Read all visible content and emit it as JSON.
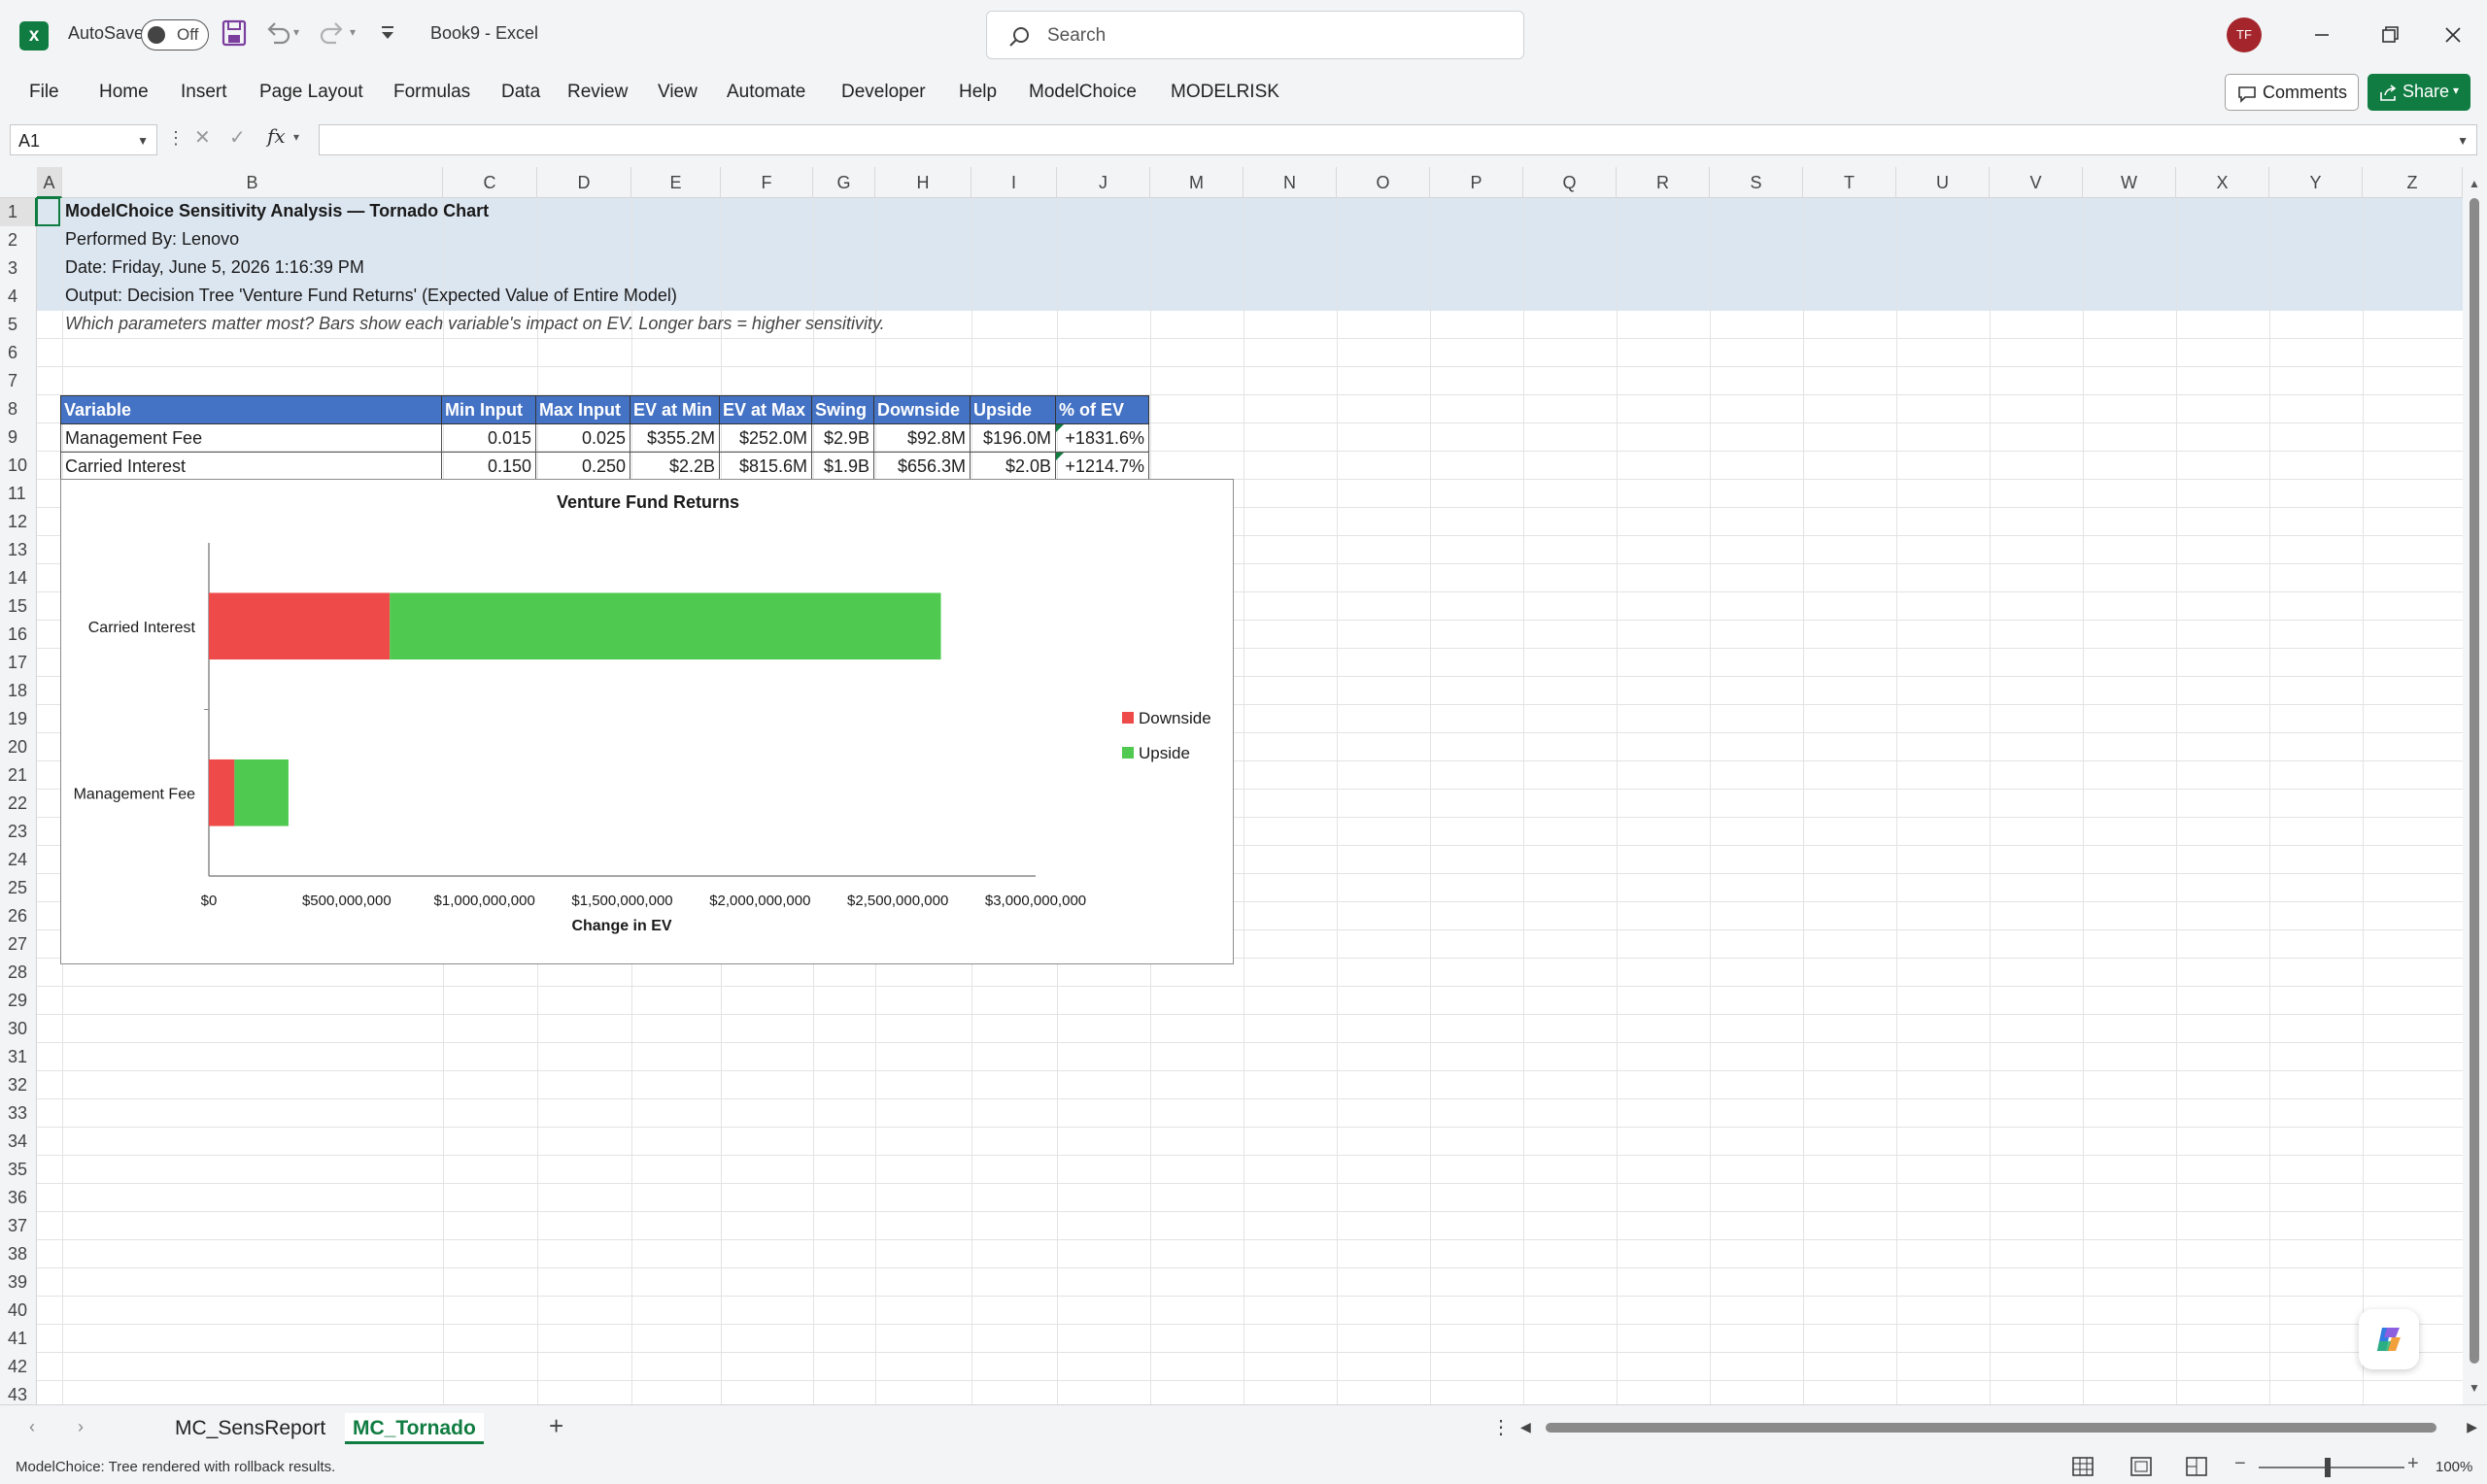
{
  "titlebar": {
    "autosave_label": "AutoSave",
    "autosave_state": "Off",
    "doc_title": "Book9  -  Excel",
    "search_placeholder": "Search",
    "user_initials": "TF",
    "icons": [
      "excel-logo-icon",
      "save-icon",
      "undo-icon",
      "redo-icon",
      "customize-qat-icon",
      "search-icon",
      "minimize-icon",
      "restore-icon",
      "close-icon"
    ]
  },
  "ribbon": {
    "tabs": [
      "File",
      "Home",
      "Insert",
      "Page Layout",
      "Formulas",
      "Data",
      "Review",
      "View",
      "Automate",
      "Developer",
      "Help",
      "ModelChoice",
      "MODELRISK"
    ],
    "comments_label": "Comments",
    "share_label": "Share"
  },
  "formula_bar": {
    "name_box": "A1",
    "formula": ""
  },
  "columns": [
    "A",
    "B",
    "C",
    "D",
    "E",
    "F",
    "G",
    "H",
    "I",
    "J",
    "M",
    "N",
    "O",
    "P",
    "Q",
    "R",
    "S",
    "T",
    "U",
    "V",
    "W",
    "X",
    "Y",
    "Z"
  ],
  "rows": [
    "1",
    "2",
    "3",
    "4",
    "5",
    "6",
    "7",
    "8",
    "9",
    "10",
    "11",
    "12",
    "13",
    "14",
    "15",
    "16",
    "17",
    "18",
    "19",
    "20",
    "21",
    "22",
    "23",
    "24",
    "25",
    "26",
    "27",
    "28",
    "29",
    "30",
    "31",
    "32",
    "33",
    "34",
    "35",
    "36",
    "37",
    "38",
    "39",
    "40",
    "41",
    "42",
    "43"
  ],
  "sheet": {
    "title": "ModelChoice Sensitivity Analysis — Tornado Chart",
    "performed_by": "Performed By: Lenovo",
    "date": "Date: Friday, June 5, 2026 1:16:39 PM",
    "output": "Output: Decision Tree 'Venture Fund Returns' (Expected Value of Entire Model)",
    "note": "Which parameters matter most? Bars show each variable's impact on EV. Longer bars = higher sensitivity."
  },
  "table": {
    "headers": [
      "Variable",
      "Min Input",
      "Max Input",
      "EV at Min",
      "EV at Max",
      "Swing",
      "Downside",
      "Upside",
      "% of EV"
    ],
    "rows": [
      [
        "Management Fee",
        "0.015",
        "0.025",
        "$355.2M",
        "$252.0M",
        "$2.9B",
        "$92.8M",
        "$196.0M",
        "+1831.6%"
      ],
      [
        "Carried Interest",
        "0.150",
        "0.250",
        "$2.2B",
        "$815.6M",
        "$1.9B",
        "$656.3M",
        "$2.0B",
        "+1214.7%"
      ]
    ]
  },
  "chart_data": {
    "type": "bar",
    "orientation": "horizontal",
    "stacked": true,
    "title": "Venture Fund Returns",
    "xlabel": "Change in EV",
    "ylabel": "",
    "categories": [
      "Carried Interest",
      "Management Fee"
    ],
    "series": [
      {
        "name": "Downside",
        "color": "#ef4a4a",
        "values": [
          656300000,
          92800000
        ]
      },
      {
        "name": "Upside",
        "color": "#4fc94f",
        "values": [
          2000000000,
          196000000
        ]
      }
    ],
    "xlim": [
      0,
      3000000000
    ],
    "x_ticks": [
      "$0",
      "$500,000,000",
      "$1,000,000,000",
      "$1,500,000,000",
      "$2,000,000,000",
      "$2,500,000,000",
      "$3,000,000,000"
    ],
    "legend_position": "right",
    "grid": false
  },
  "sheet_tabs": [
    "MC_SensReport",
    "MC_Tornado"
  ],
  "active_tab": "MC_Tornado",
  "status": {
    "text": "ModelChoice: Tree rendered with rollback results.",
    "zoom": "100%"
  }
}
